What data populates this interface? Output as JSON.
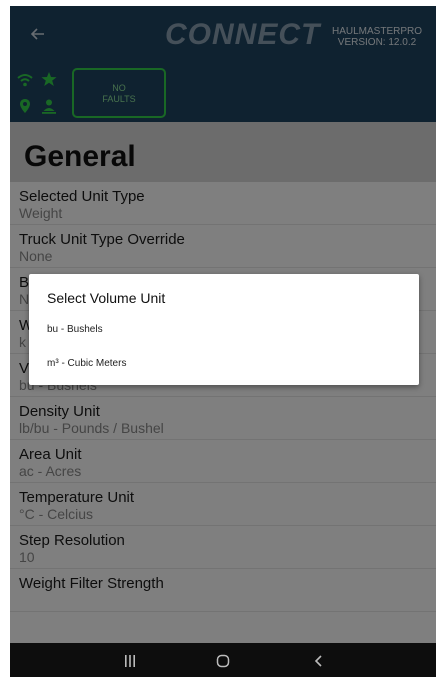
{
  "header": {
    "logo_text": "CONNECT",
    "app_name": "HAULMASTERPRO",
    "version": "VERSION: 12.0.2",
    "back_icon": "back-arrow-icon"
  },
  "status": {
    "icons": [
      "wifi-icon",
      "star-icon",
      "location-pin-icon",
      "person-icon"
    ],
    "faults_line1": "NO",
    "faults_line2": "FAULTS",
    "accent_color": "#33d04b"
  },
  "section": {
    "title": "General"
  },
  "settings": [
    {
      "label": "Selected Unit Type",
      "value": "Weight"
    },
    {
      "label": "Truck Unit Type Override",
      "value": "None"
    },
    {
      "label": "B",
      "value": "N"
    },
    {
      "label": "W",
      "value": "k"
    },
    {
      "label": "V",
      "value": "bu - Bushels"
    },
    {
      "label": "Density Unit",
      "value": "lb/bu - Pounds / Bushel"
    },
    {
      "label": "Area Unit",
      "value": "ac - Acres"
    },
    {
      "label": "Temperature Unit",
      "value": "°C - Celcius"
    },
    {
      "label": "Step Resolution",
      "value": "10"
    },
    {
      "label": "Weight Filter Strength",
      "value": ""
    }
  ],
  "dialog": {
    "title": "Select Volume Unit",
    "options": [
      "bu - Bushels",
      "m³ - Cubic Meters"
    ]
  },
  "navbar": {
    "icons": [
      "recents-icon",
      "home-icon",
      "back-icon"
    ]
  },
  "colors": {
    "header_bg": "#1f4461",
    "section_bg": "#d9d9d9"
  }
}
